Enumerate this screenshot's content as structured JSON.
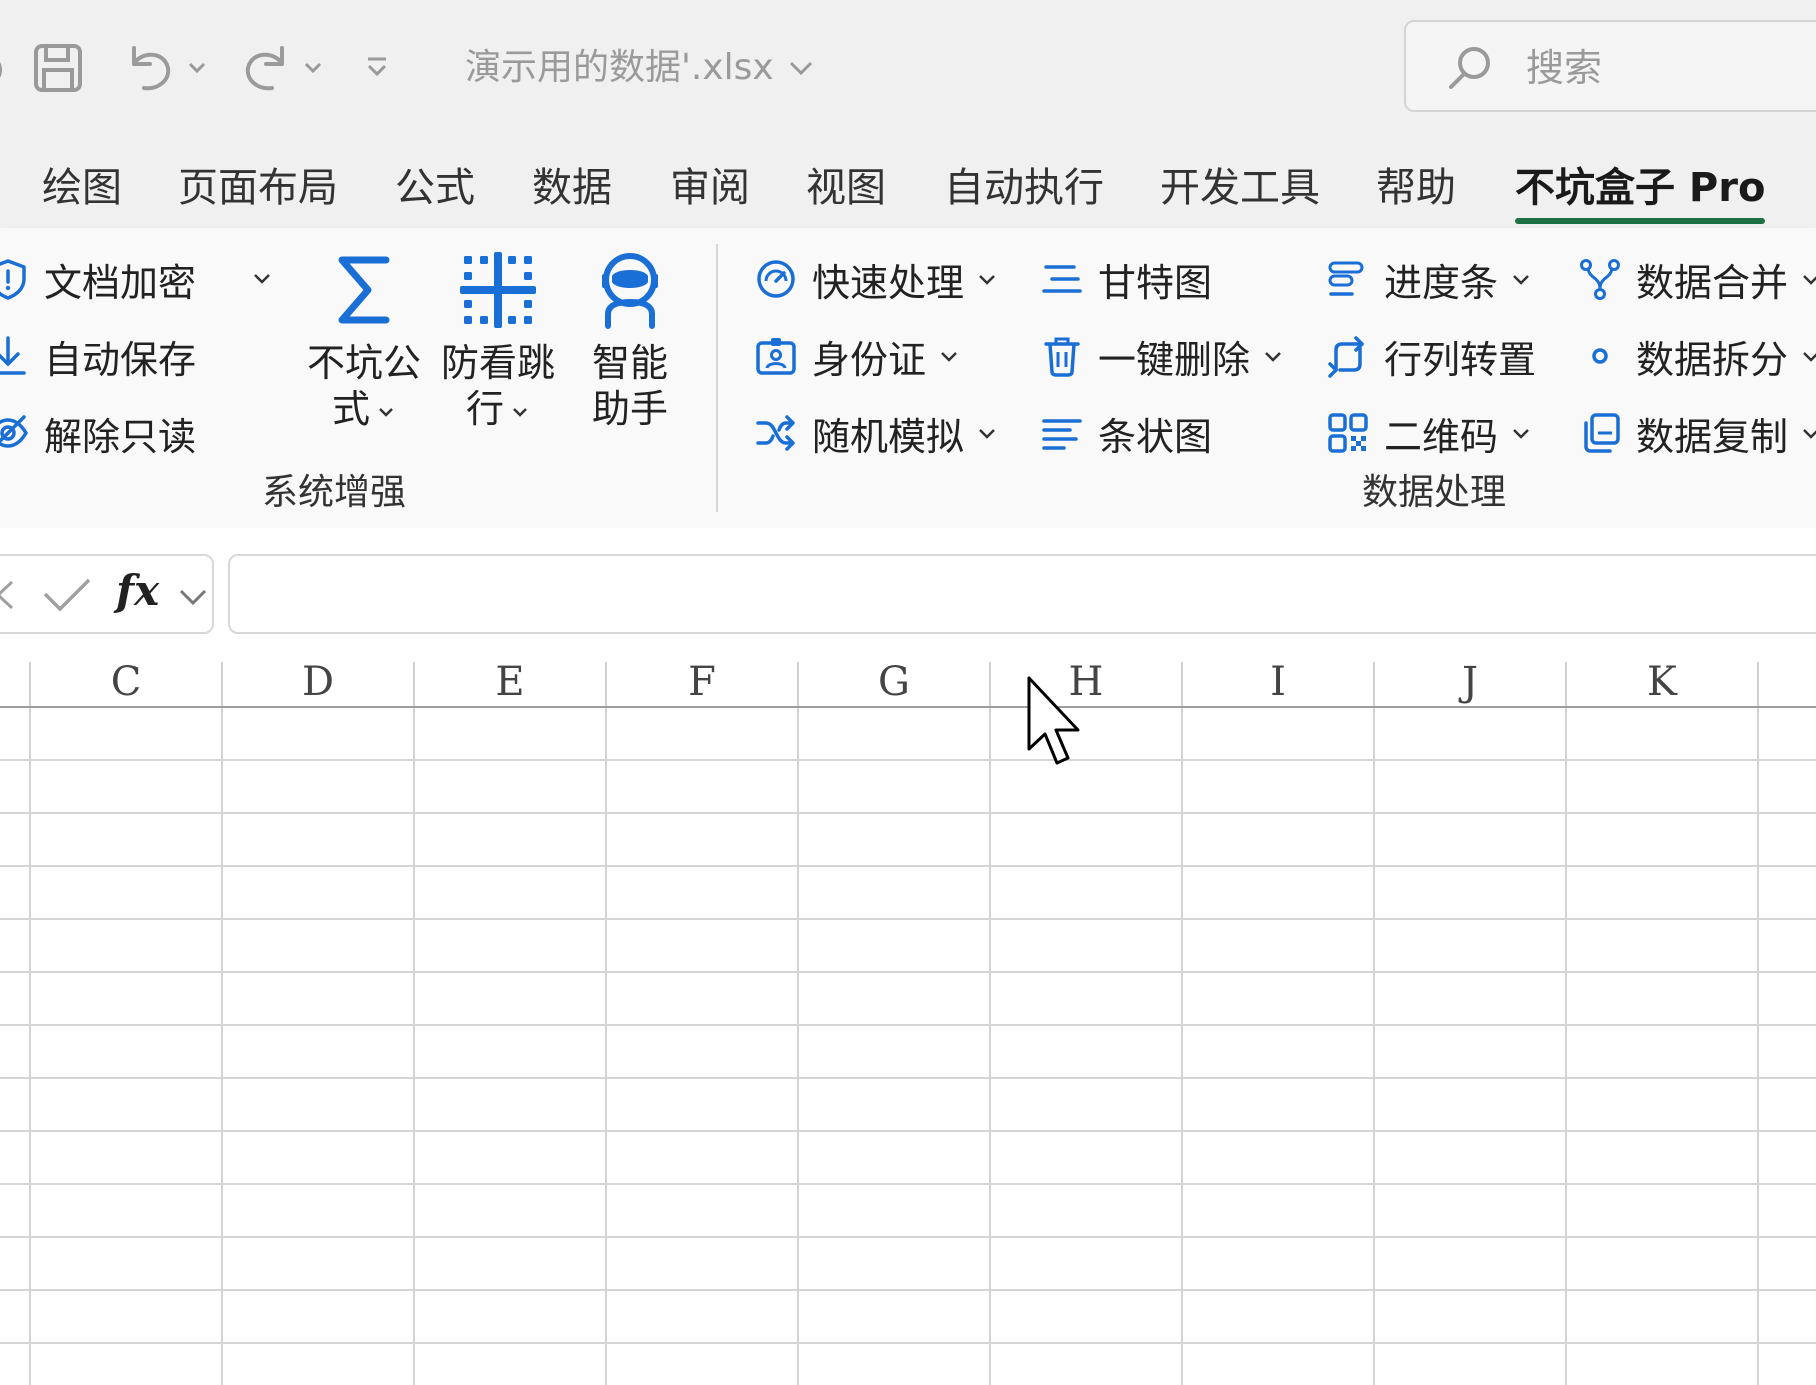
{
  "titlebar": {
    "document_title": "演示用的数据'.xlsx",
    "search_placeholder": "搜索"
  },
  "tabs": [
    {
      "label": "绘图"
    },
    {
      "label": "页面布局"
    },
    {
      "label": "公式"
    },
    {
      "label": "数据"
    },
    {
      "label": "审阅"
    },
    {
      "label": "视图"
    },
    {
      "label": "自动执行"
    },
    {
      "label": "开发工具"
    },
    {
      "label": "帮助"
    },
    {
      "label": "不坑盒子 Pro",
      "active": true
    }
  ],
  "ribbon": {
    "system": {
      "group_label": "系统增强",
      "items": [
        {
          "label": "文档加密",
          "icon": "shield-icon"
        },
        {
          "label": "自动保存",
          "icon": "download-icon"
        },
        {
          "label": "解除只读",
          "icon": "eye-off-icon"
        }
      ],
      "big": [
        {
          "line1": "不坑公",
          "line2": "式",
          "icon": "sigma-icon"
        },
        {
          "line1": "防看跳",
          "line2": "行",
          "icon": "grid-dots-icon"
        },
        {
          "line1": "智能",
          "line2": "助手",
          "icon": "robot-icon"
        }
      ]
    },
    "data": {
      "group_label": "数据处理",
      "col1": [
        {
          "label": "快速处理",
          "icon": "speed-icon"
        },
        {
          "label": "身份证",
          "icon": "id-card-icon"
        },
        {
          "label": "随机模拟",
          "icon": "shuffle-icon"
        }
      ],
      "col2": [
        {
          "label": "甘特图",
          "icon": "gantt-icon"
        },
        {
          "label": "一键删除",
          "icon": "trash-icon"
        },
        {
          "label": "条状图",
          "icon": "bars-icon"
        }
      ],
      "col3": [
        {
          "label": "进度条",
          "icon": "progress-icon"
        },
        {
          "label": "行列转置",
          "icon": "transpose-icon"
        },
        {
          "label": "二维码",
          "icon": "qrcode-icon"
        }
      ],
      "col4": [
        {
          "label": "数据合并",
          "icon": "merge-icon"
        },
        {
          "label": "数据拆分",
          "icon": "split-icon"
        },
        {
          "label": "数据复制",
          "icon": "copy-icon"
        }
      ]
    }
  },
  "formula_bar": {
    "fx_label": "fx",
    "value": ""
  },
  "columns": [
    "C",
    "D",
    "E",
    "F",
    "G",
    "H",
    "I",
    "J",
    "K"
  ],
  "colors": {
    "accent_green": "#1e7145",
    "icon_blue": "#1a6fd6"
  }
}
